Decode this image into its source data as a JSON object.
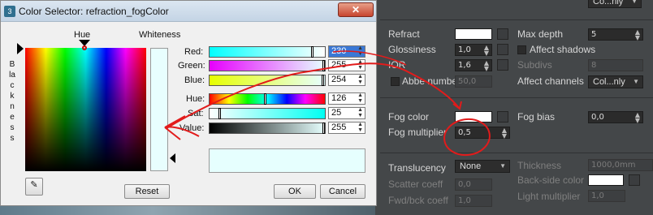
{
  "dialog": {
    "title": "Color Selector: refraction_fogColor",
    "close_glyph": "✕",
    "hue_label": "Hue",
    "whiteness_label": "Whiteness",
    "blackness_label": "Blackness",
    "sliders": [
      {
        "label": "Red:",
        "value": "230",
        "fraction": 0.9
      },
      {
        "label": "Green:",
        "value": "255",
        "fraction": 1.0
      },
      {
        "label": "Blue:",
        "value": "254",
        "fraction": 0.996
      },
      {
        "label": "Hue:",
        "value": "126",
        "fraction": 0.49
      },
      {
        "label": "Sat:",
        "value": "25",
        "fraction": 0.1
      },
      {
        "label": "Value:",
        "value": "255",
        "fraction": 1.0
      }
    ],
    "reset_label": "Reset",
    "ok_label": "OK",
    "cancel_label": "Cancel",
    "current_color": "#e6fffe"
  },
  "panel": {
    "top_dropdown": "Co...nly",
    "refract_label": "Refract",
    "max_depth_label": "Max depth",
    "max_depth_value": "5",
    "glossiness_label": "Glossiness",
    "glossiness_value": "1,0",
    "affect_shadows_label": "Affect shadows",
    "ior_label": "IOR",
    "ior_value": "1,6",
    "subdivs_label": "Subdivs",
    "subdivs_value": "8",
    "abbe_label": "Abbe number",
    "abbe_value": "50,0",
    "affect_channels_label": "Affect channels",
    "affect_channels_value": "Col...nly",
    "fog_color_label": "Fog color",
    "fog_bias_label": "Fog bias",
    "fog_bias_value": "0,0",
    "fog_multiplier_label": "Fog multiplier",
    "fog_multiplier_value": "0,5",
    "translucency_label": "Translucency",
    "translucency_value": "None",
    "thickness_label": "Thickness",
    "thickness_value": "1000,0mm",
    "scatter_label": "Scatter coeff",
    "scatter_value": "0,0",
    "backside_label": "Back-side color",
    "fwd_label": "Fwd/bck coeff",
    "fwd_value": "1,0",
    "light_mult_label": "Light multiplier",
    "light_mult_value": "1,0"
  },
  "colors": {
    "annotation": "#e21b1b",
    "panel_bg": "#444749",
    "refract_swatch": "#ffffff",
    "fog_swatch": "#ffffff"
  }
}
